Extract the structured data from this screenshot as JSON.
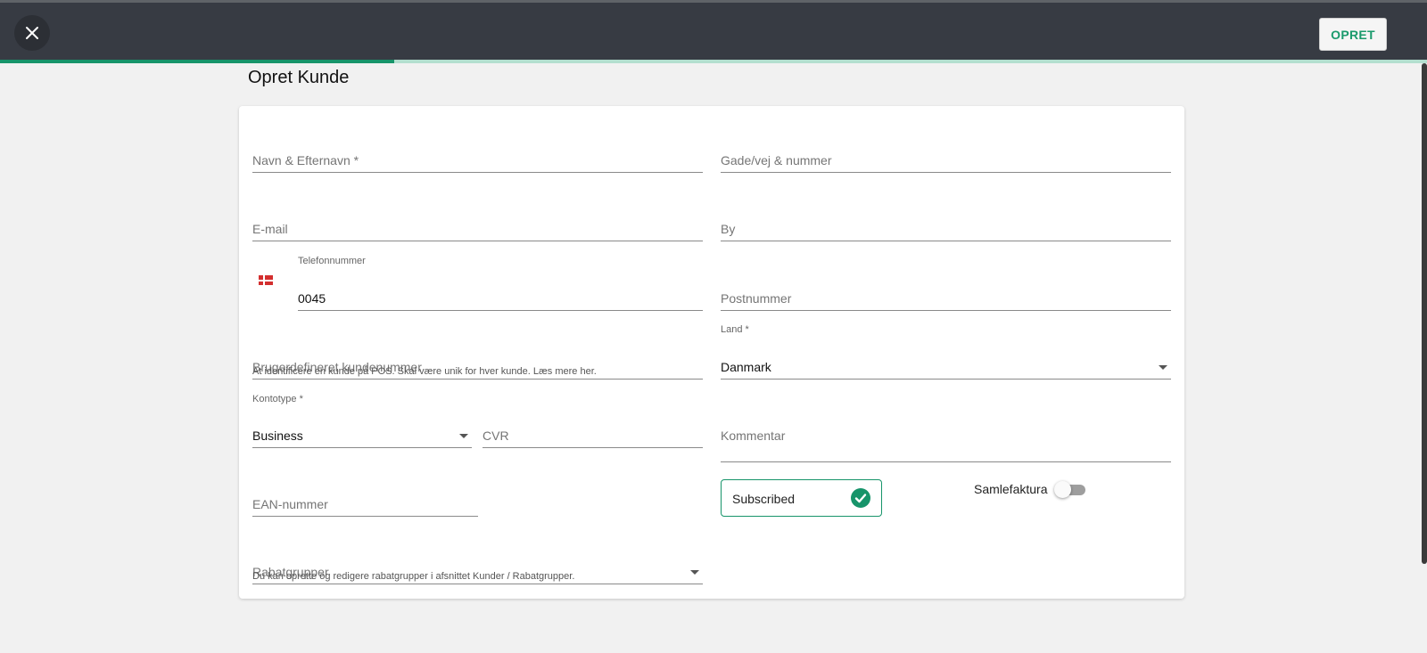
{
  "header": {
    "create_label": "OPRET",
    "progress_fraction": 0.276
  },
  "page": {
    "title": "Opret Kunde"
  },
  "form": {
    "name": {
      "placeholder": "Navn & Efternavn *"
    },
    "street": {
      "placeholder": "Gade/vej & nummer"
    },
    "email": {
      "placeholder": "E-mail"
    },
    "city": {
      "placeholder": "By"
    },
    "phone": {
      "label": "Telefonnummer",
      "value": "0045",
      "flag": "denmark-flag-icon"
    },
    "postal": {
      "placeholder": "Postnummer"
    },
    "custom_number": {
      "placeholder": "Brugerdefineret kundenummer",
      "hint": "At identificere en kunde på POS. Skal være unik for hver kunde. Læs mere her."
    },
    "country": {
      "label": "Land *",
      "value": "Danmark"
    },
    "account_type": {
      "label": "Kontotype *",
      "value": "Business"
    },
    "cvr": {
      "placeholder": "CVR"
    },
    "comment": {
      "placeholder": "Kommentar"
    },
    "ean": {
      "placeholder": "EAN-nummer"
    },
    "subscribed": {
      "label": "Subscribed",
      "checked": true
    },
    "collective_invoice": {
      "label": "Samlefaktura",
      "enabled": false
    },
    "discount_groups": {
      "placeholder": "Rabatgrupper",
      "hint": "Du kan oprette og redigere rabatgrupper i afsnittet Kunder / Rabatgrupper."
    }
  },
  "colors": {
    "accent": "#17946a",
    "topbar": "#373b43",
    "background": "#f1f1f1"
  }
}
